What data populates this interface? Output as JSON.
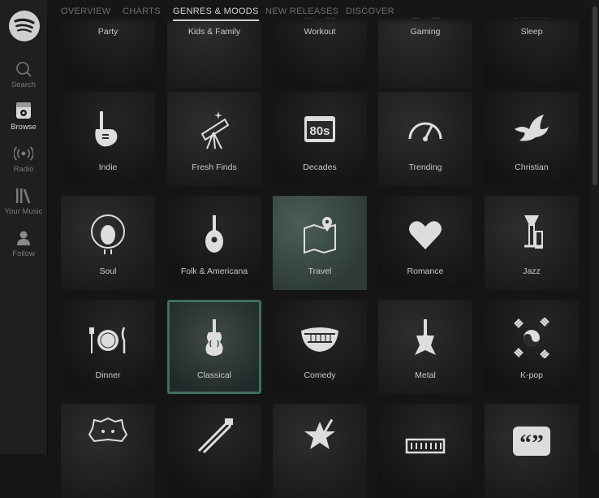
{
  "sidebar": {
    "items": [
      {
        "label": "Search",
        "icon": "search-icon"
      },
      {
        "label": "Browse",
        "icon": "browse-icon"
      },
      {
        "label": "Radio",
        "icon": "radio-icon"
      },
      {
        "label": "Your Music",
        "icon": "library-icon"
      },
      {
        "label": "Follow",
        "icon": "follow-icon"
      }
    ],
    "active": "Browse"
  },
  "tabs": [
    {
      "label": "OVERVIEW"
    },
    {
      "label": "CHARTS"
    },
    {
      "label": "GENRES & MOODS"
    },
    {
      "label": "NEW RELEASES"
    },
    {
      "label": "DISCOVER"
    }
  ],
  "active_tab": "GENRES & MOODS",
  "genres": [
    {
      "label": "Party",
      "icon": "disco-ball-icon"
    },
    {
      "label": "Kids & Family",
      "icon": "balloons-icon"
    },
    {
      "label": "Workout",
      "icon": "dumbbell-icon"
    },
    {
      "label": "Gaming",
      "icon": "gamepad-icon"
    },
    {
      "label": "Sleep",
      "icon": "bed-icon"
    },
    {
      "label": "Indie",
      "icon": "electric-guitar-icon"
    },
    {
      "label": "Fresh Finds",
      "icon": "telescope-icon"
    },
    {
      "label": "Decades",
      "icon": "80s-icon"
    },
    {
      "label": "Trending",
      "icon": "gauge-icon"
    },
    {
      "label": "Christian",
      "icon": "dove-icon"
    },
    {
      "label": "Soul",
      "icon": "afro-face-icon"
    },
    {
      "label": "Folk & Americana",
      "icon": "mandolin-icon"
    },
    {
      "label": "Travel",
      "icon": "map-pin-icon"
    },
    {
      "label": "Romance",
      "icon": "heart-icon"
    },
    {
      "label": "Jazz",
      "icon": "trumpet-icon"
    },
    {
      "label": "Dinner",
      "icon": "plate-cutlery-icon"
    },
    {
      "label": "Classical",
      "icon": "violin-icon"
    },
    {
      "label": "Comedy",
      "icon": "teeth-icon"
    },
    {
      "label": "Metal",
      "icon": "metal-guitar-icon"
    },
    {
      "label": "K-pop",
      "icon": "korean-flag-icon"
    },
    {
      "label": "",
      "icon": "lion-icon"
    },
    {
      "label": "",
      "icon": "safety-pin-icon"
    },
    {
      "label": "",
      "icon": "star-guitar-icon"
    },
    {
      "label": "",
      "icon": "harmonica-icon"
    },
    {
      "label": "",
      "icon": "quote-icon"
    }
  ],
  "selected_genre": "Classical",
  "colors": {
    "accent": "#3f6e62",
    "background": "#151515",
    "sidebar": "#1f1f1f"
  }
}
